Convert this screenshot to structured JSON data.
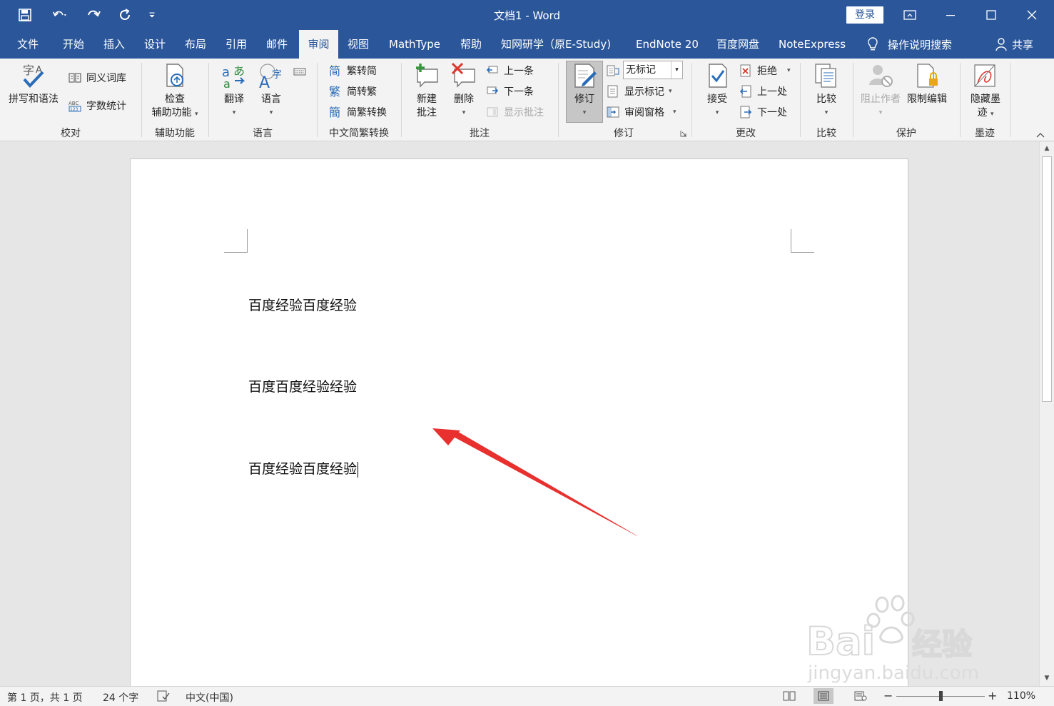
{
  "titlebar": {
    "doc_title": "文档1  -  Word",
    "login_label": "登录"
  },
  "tabs": [
    {
      "label": "文件"
    },
    {
      "label": "开始"
    },
    {
      "label": "插入"
    },
    {
      "label": "设计"
    },
    {
      "label": "布局"
    },
    {
      "label": "引用"
    },
    {
      "label": "邮件"
    },
    {
      "label": "审阅"
    },
    {
      "label": "视图"
    },
    {
      "label": "MathType"
    },
    {
      "label": "帮助"
    },
    {
      "label": "知网研学（原E-Study)"
    },
    {
      "label": "EndNote 20"
    },
    {
      "label": "百度网盘"
    },
    {
      "label": "NoteExpress"
    }
  ],
  "tell_me": "操作说明搜索",
  "share": "共享",
  "ribbon": {
    "proofing": {
      "group": "校对",
      "spelling": "拼写和语法",
      "thesaurus": "同义词库",
      "wordcount": "字数统计"
    },
    "accessibility": {
      "group": "辅助功能",
      "check_line1": "检查",
      "check_line2": "辅助功能"
    },
    "language": {
      "group": "语言",
      "translate": "翻译",
      "language": "语言"
    },
    "chinese": {
      "group": "中文简繁转换",
      "to_simplified": "繁转简",
      "to_traditional": "简转繁",
      "convert": "简繁转换"
    },
    "comments": {
      "group": "批注",
      "new_line1": "新建",
      "new_line2": "批注",
      "delete": "删除",
      "prev": "上一条",
      "next": "下一条",
      "show": "显示批注"
    },
    "tracking": {
      "group": "修订",
      "track": "修订",
      "markup_value": "无标记",
      "show_markup": "显示标记",
      "reviewing_pane": "审阅窗格"
    },
    "changes": {
      "group": "更改",
      "accept": "接受",
      "reject": "拒绝",
      "prev": "上一处",
      "next": "下一处"
    },
    "compare": {
      "group": "比较",
      "compare": "比较"
    },
    "protect": {
      "group": "保护",
      "block_authors": "阻止作者",
      "restrict": "限制编辑"
    },
    "ink": {
      "group": "墨迹",
      "hide_line1": "隐藏墨",
      "hide_line2": "迹"
    }
  },
  "document": {
    "paragraphs": [
      "百度经验百度经验",
      "百度百度经验经验",
      "百度经验百度经验"
    ]
  },
  "statusbar": {
    "page": "第 1 页，共 1 页",
    "words": "24 个字",
    "language": "中文(中国)",
    "zoom": "110%"
  },
  "colors": {
    "accent": "#2b579a",
    "arrow": "#e8312f"
  }
}
